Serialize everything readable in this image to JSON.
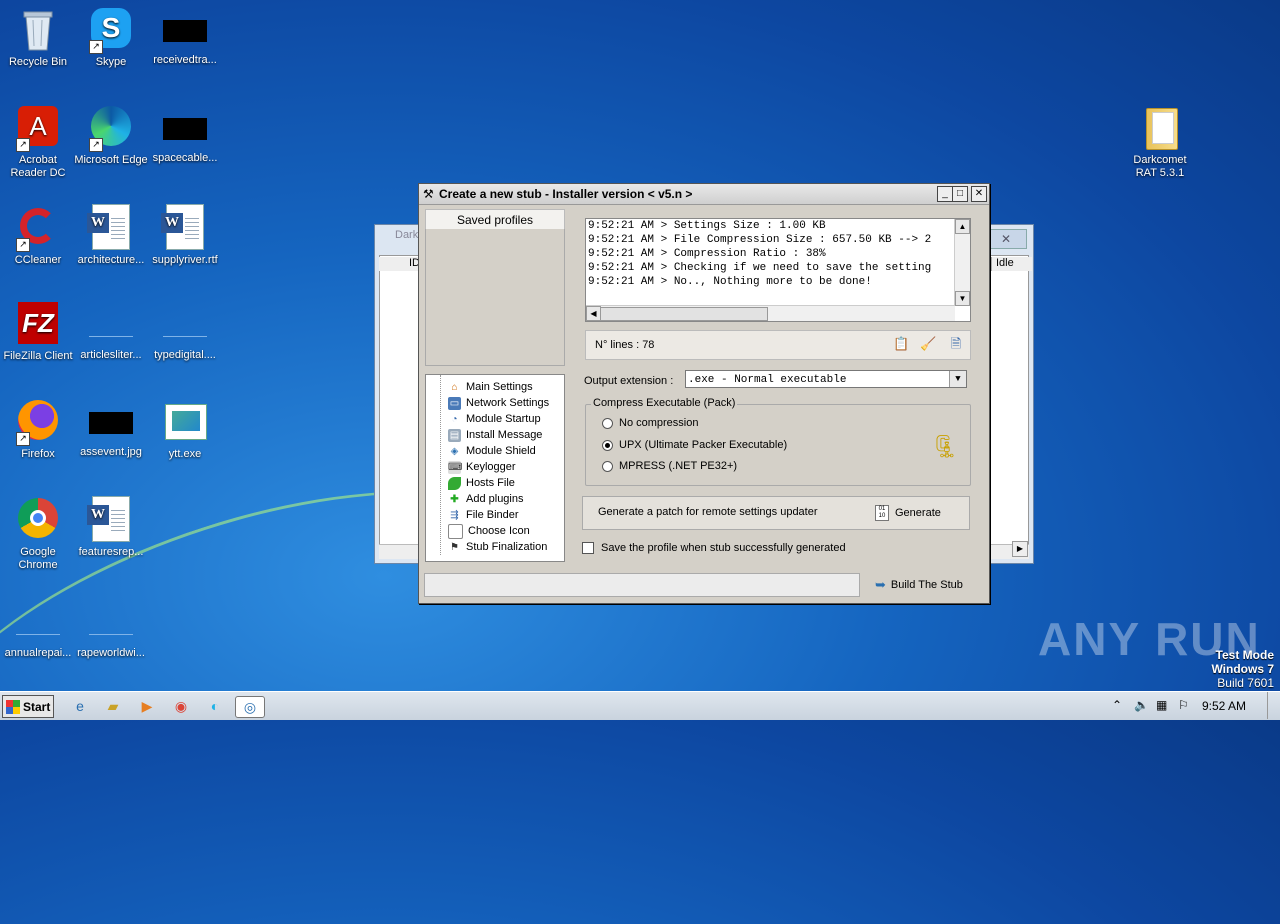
{
  "desktop": {
    "icons": [
      {
        "label": "Recycle Bin"
      },
      {
        "label": "Skype"
      },
      {
        "label": "receivedtra..."
      },
      {
        "label": "Acrobat Reader DC"
      },
      {
        "label": "Microsoft Edge"
      },
      {
        "label": "spacecable..."
      },
      {
        "label": "CCleaner"
      },
      {
        "label": "architecture..."
      },
      {
        "label": "supplyriver.rtf"
      },
      {
        "label": "FileZilla Client"
      },
      {
        "label": "articlesliter..."
      },
      {
        "label": "typedigital...."
      },
      {
        "label": "Firefox"
      },
      {
        "label": "assevent.jpg"
      },
      {
        "label": "ytt.exe"
      },
      {
        "label": "Google Chrome"
      },
      {
        "label": "featuresrep..."
      },
      {
        "label": "annualrepai..."
      },
      {
        "label": "rapeworldwi..."
      },
      {
        "label": "Darkcomet RAT 5.3.1"
      }
    ]
  },
  "bg_window": {
    "close_glyph": "✕",
    "col_id": "ID",
    "col_idle": "Idle",
    "title_partial": "Dark"
  },
  "dialog": {
    "title": "Create a new stub - Installer version < v5.n >",
    "saved_profiles": "Saved profiles",
    "tree": [
      {
        "label": "Main Settings",
        "icon": "home-icon"
      },
      {
        "label": "Network Settings",
        "icon": "network-icon"
      },
      {
        "label": "Module Startup",
        "icon": "startup-icon"
      },
      {
        "label": "Install Message",
        "icon": "message-icon"
      },
      {
        "label": "Module Shield",
        "icon": "shield-icon"
      },
      {
        "label": "Keylogger",
        "icon": "keyboard-icon"
      },
      {
        "label": "Hosts File",
        "icon": "leaf-icon"
      },
      {
        "label": "Add plugins",
        "icon": "puzzle-icon"
      },
      {
        "label": "File Binder",
        "icon": "binder-icon"
      },
      {
        "label": "Choose Icon",
        "icon": "image-icon"
      },
      {
        "label": "Stub Finalization",
        "icon": "flag-icon"
      }
    ],
    "log_lines": [
      "9:52:21 AM > Settings Size : 1.00 KB",
      "9:52:21 AM > File Compression Size : 657.50 KB --> 2",
      "9:52:21 AM > Compression Ratio : 38%",
      "9:52:21 AM > Checking if we need to save the setting",
      "9:52:21 AM > No.., Nothing more to be done!"
    ],
    "lines_count": "N° lines : 78",
    "output_extension_label": "Output extension :",
    "output_extension_value": ".exe - Normal executable",
    "compress_group": "Compress Executable (Pack)",
    "compress_options": [
      {
        "label": "No compression",
        "selected": false
      },
      {
        "label": "UPX (Ultimate Packer Executable)",
        "selected": true
      },
      {
        "label": "MPRESS (.NET PE32+)",
        "selected": false
      }
    ],
    "patch_text": "Generate a patch for remote settings updater",
    "generate_label": "Generate",
    "save_profile_label": "Save the profile when stub successfully generated",
    "build_label": "Build The Stub"
  },
  "taskbar": {
    "start_label": "Start",
    "clock": "9:52 AM"
  },
  "watermark": "ANY RUN",
  "testmode": {
    "line1": "Test Mode",
    "line2": "Windows 7",
    "line3": "Build 7601"
  }
}
